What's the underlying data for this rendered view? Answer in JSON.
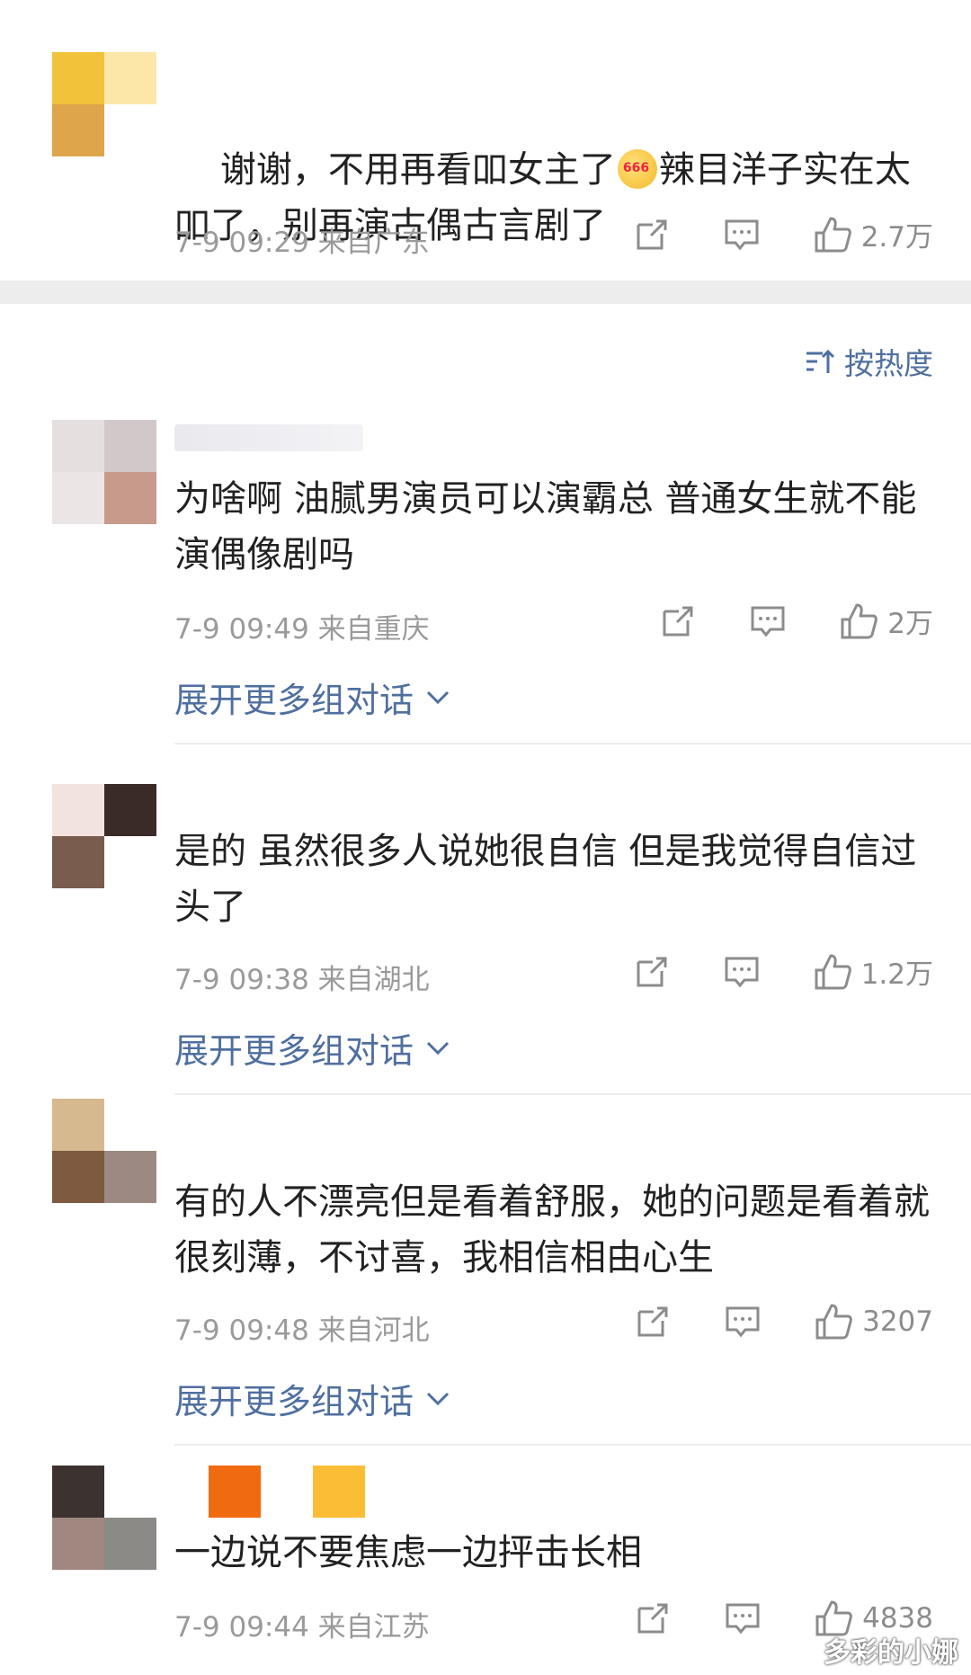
{
  "sort_label": "按热度",
  "expand_label": "展开更多组对话",
  "comments": [
    {
      "text": "谢谢，不用再看吅女主了",
      "emoji": "666-emoji",
      "text_after_emoji": "辣目洋子实在太吅了，别再演古偶古言剧了",
      "meta": "7-9 09:29 来自广东",
      "likes": "2.7万",
      "avatar_colors": [
        "#f2c23b",
        "#fde7a8",
        "#dea54b",
        "#ffffff"
      ]
    },
    {
      "text": "为啥啊 油腻男演员可以演霸总 普通女生就不能演偶像剧吗",
      "meta": "7-9 09:49 来自重庆",
      "likes": "2万",
      "avatar_colors": [
        "#e6dfe0",
        "#d2c8c9",
        "#ebe5e6",
        "#c89a8c"
      ]
    },
    {
      "text": "是的 虽然很多人说她很自信 但是我觉得自信过头了",
      "meta": "7-9 09:38 来自湖北",
      "likes": "1.2万",
      "avatar_colors": [
        "#f3e3df",
        "#3a2a28",
        "#7a5c4e",
        "#ffffff"
      ]
    },
    {
      "text": "有的人不漂亮但是看着舒服，她的问题是看着就很刻薄，不讨喜，我相信相由心生",
      "meta": "7-9 09:48 来自河北",
      "likes": "3207",
      "avatar_colors": [
        "#d6b98f",
        "#ffffff",
        "#7d5a40",
        "#9c8a82"
      ]
    },
    {
      "text": "一边说不要焦虑一边抨击长相",
      "meta": "7-9 09:44 来自江苏",
      "likes": "4838",
      "avatar_colors": [
        "#3c3330",
        "#ffffff",
        "#a08880",
        "#8c8a86"
      ]
    }
  ],
  "name_badges": [
    "#f06a10",
    "#fbbd35"
  ],
  "watermark": "多彩的小娜"
}
